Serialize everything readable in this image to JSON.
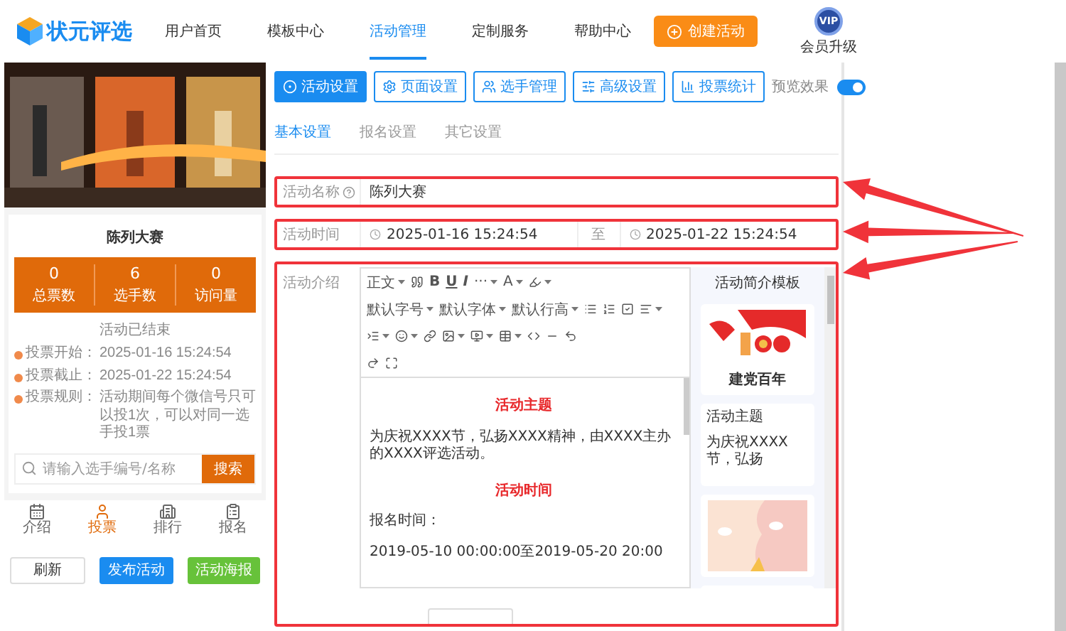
{
  "header": {
    "logo": "状元评选",
    "nav": [
      {
        "label": "用户首页",
        "selected": false
      },
      {
        "label": "模板中心",
        "selected": false
      },
      {
        "label": "活动管理",
        "selected": true
      },
      {
        "label": "定制服务",
        "selected": false
      },
      {
        "label": "帮助中心",
        "selected": false
      }
    ],
    "create_button": "创建活动",
    "vip_badge": "VIP",
    "vip_label": "会员升级"
  },
  "preview": {
    "title": "陈列大赛",
    "stats": [
      {
        "value": "0",
        "label": "总票数"
      },
      {
        "value": "6",
        "label": "选手数"
      },
      {
        "value": "0",
        "label": "访问量"
      }
    ],
    "status": "活动已结束",
    "info": [
      {
        "label": "投票开始：",
        "value": "2025-01-16 15:24:54"
      },
      {
        "label": "投票截止：",
        "value": "2025-01-22 15:24:54"
      },
      {
        "label": "投票规则：",
        "value": "活动期间每个微信号只可以投1次，可以对同一选手投1票"
      }
    ],
    "search": {
      "placeholder": "请输入选手编号/名称",
      "button": "搜索"
    },
    "bottom_nav": [
      {
        "label": "介绍",
        "selected": false
      },
      {
        "label": "投票",
        "selected": true
      },
      {
        "label": "排行",
        "selected": false
      },
      {
        "label": "报名",
        "selected": false
      }
    ],
    "actions": [
      {
        "label": "刷新",
        "kind": "default"
      },
      {
        "label": "发布活动",
        "kind": "primary"
      },
      {
        "label": "活动海报",
        "kind": "success"
      }
    ]
  },
  "tabs": [
    {
      "label": "活动设置",
      "selected": true
    },
    {
      "label": "页面设置",
      "selected": false
    },
    {
      "label": "选手管理",
      "selected": false
    },
    {
      "label": "高级设置",
      "selected": false
    },
    {
      "label": "投票统计",
      "selected": false
    }
  ],
  "preview_toggle": {
    "label": "预览效果",
    "on": true
  },
  "subtabs": [
    {
      "label": "基本设置",
      "selected": true
    },
    {
      "label": "报名设置",
      "selected": false
    },
    {
      "label": "其它设置",
      "selected": false
    }
  ],
  "form": {
    "name": {
      "label": "活动名称",
      "value": "陈列大赛",
      "highlighted": true
    },
    "time": {
      "label": "活动时间",
      "start": "2025-01-16 15:24:54",
      "separator": "至",
      "end": "2025-01-22 15:24:54",
      "highlighted": true
    },
    "intro": {
      "label": "活动介绍",
      "highlighted": true
    }
  },
  "editor": {
    "toolbar": [
      [
        {
          "kind": "dropdown",
          "label": "正文"
        },
        {
          "kind": "icon"
        },
        {
          "kind": "glyph",
          "label": "B"
        },
        {
          "kind": "glyph",
          "label": "U"
        },
        {
          "kind": "glyph",
          "label": "I"
        },
        {
          "kind": "dropdown",
          "label": "···"
        },
        {
          "kind": "dropdown",
          "label": "A"
        },
        {
          "kind": "icon",
          "caret": true
        }
      ],
      [
        {
          "kind": "dropdown",
          "label": "默认字号"
        },
        {
          "kind": "dropdown",
          "label": "默认字体"
        },
        {
          "kind": "dropdown",
          "label": "默认行高"
        },
        {
          "kind": "icon"
        },
        {
          "kind": "icon"
        },
        {
          "kind": "icon"
        },
        {
          "kind": "icon",
          "caret": true
        }
      ],
      [
        {
          "kind": "icon",
          "caret": true
        },
        {
          "kind": "icon",
          "caret": true
        },
        {
          "kind": "icon"
        },
        {
          "kind": "icon",
          "caret": true
        },
        {
          "kind": "icon",
          "caret": true
        },
        {
          "kind": "icon",
          "caret": true
        },
        {
          "kind": "icon"
        },
        {
          "kind": "icon"
        },
        {
          "kind": "icon"
        }
      ],
      [
        {
          "kind": "icon"
        },
        {
          "kind": "icon"
        }
      ]
    ],
    "content": [
      {
        "kind": "heading",
        "text": "活动主题"
      },
      {
        "kind": "text",
        "text": "为庆祝XXXX节，弘扬XXXX精神，由XXXX主办的XXXX评选活动。"
      },
      {
        "kind": "heading",
        "text": "活动时间"
      },
      {
        "kind": "text",
        "text": "报名时间："
      },
      {
        "kind": "text",
        "text": "2019-05-10 00:00:00至2019-05-20 20:00"
      }
    ],
    "templates_title": "活动简介模板",
    "templates": [
      {
        "kind": "picture",
        "caption": "建党百年"
      },
      {
        "kind": "text",
        "title": "活动主题",
        "excerpt": "为庆祝XXXX节，弘扬"
      },
      {
        "kind": "picture"
      },
      {
        "kind": "blank"
      }
    ]
  }
}
